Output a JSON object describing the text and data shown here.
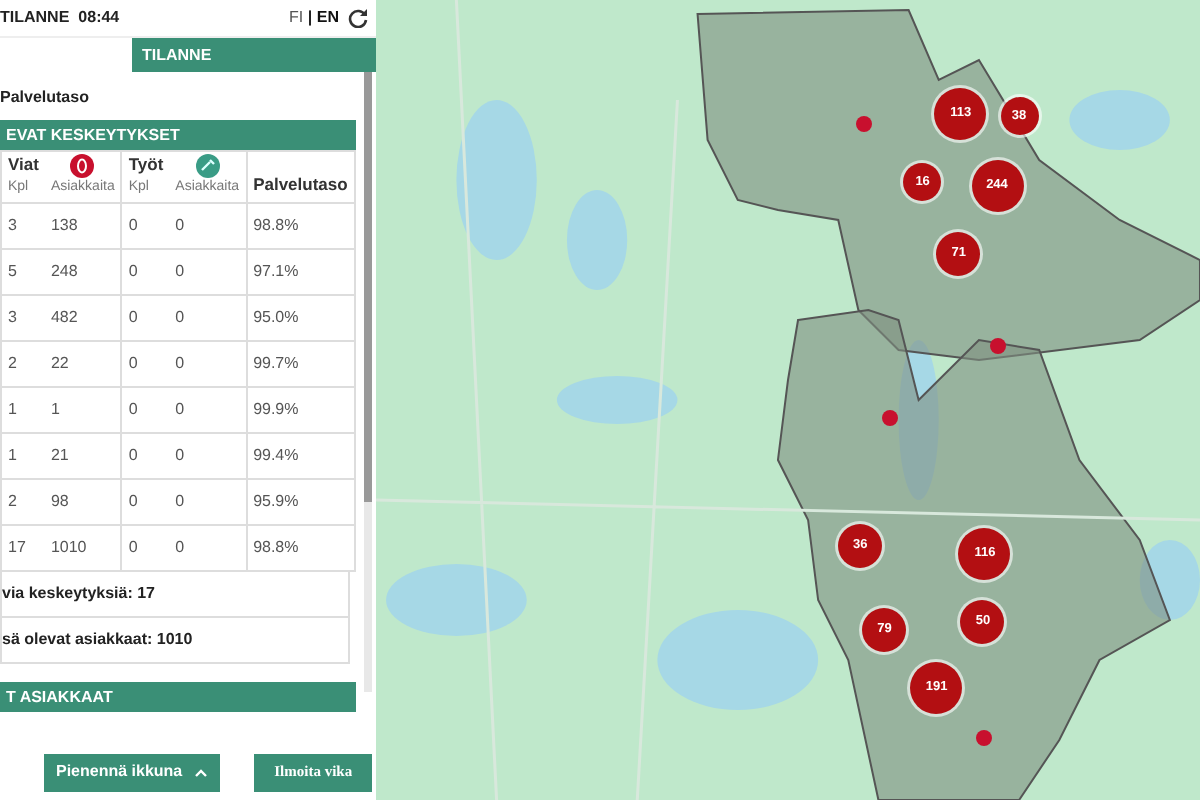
{
  "header": {
    "title": "TILANNE",
    "time": "08:44",
    "separator": "|",
    "languages": [
      {
        "label": "FI",
        "selected": false
      },
      {
        "label": "EN",
        "selected": true
      }
    ]
  },
  "tabs": [
    {
      "label": "TILANNE",
      "selected": true
    }
  ],
  "section_label": "Palvelutaso",
  "outages": {
    "title": "EVAT KESKEYTYKSET",
    "groups": [
      {
        "label": "Viat",
        "kind": "fault"
      },
      {
        "label": "Työt",
        "kind": "work"
      }
    ],
    "columns": [
      "Kpl",
      "Asiakkaita",
      "Kpl",
      "Asiakkaita",
      "Palvelutaso"
    ],
    "rows": [
      [
        "3",
        "138",
        "0",
        "0",
        "98.8%"
      ],
      [
        "5",
        "248",
        "0",
        "0",
        "97.1%"
      ],
      [
        "3",
        "482",
        "0",
        "0",
        "95.0%"
      ],
      [
        "2",
        "22",
        "0",
        "0",
        "99.7%"
      ],
      [
        "1",
        "1",
        "0",
        "0",
        "99.9%"
      ],
      [
        "1",
        "21",
        "0",
        "0",
        "99.4%"
      ],
      [
        "2",
        "98",
        "0",
        "0",
        "95.9%"
      ],
      [
        "17",
        "1010",
        "0",
        "0",
        "98.8%"
      ]
    ],
    "summary": [
      "via keskeytyksiä: 17",
      "sä olevat asiakkaat: 1010"
    ]
  },
  "customers": {
    "title": "T ASIAKKAAT"
  },
  "buttons": [
    {
      "label": "Pienennä ikkuna",
      "kind": "toggle"
    },
    {
      "label": "Ilmoita vika",
      "kind": "plain"
    }
  ],
  "map": {
    "clusters": [
      {
        "count": "113",
        "kind": "large"
      },
      {
        "count": "38",
        "kind": "small"
      },
      {
        "count": "16",
        "kind": "small"
      },
      {
        "count": "244",
        "kind": "large"
      },
      {
        "count": "71",
        "kind": "medium"
      },
      {
        "count": "36",
        "kind": "medium"
      },
      {
        "count": "116",
        "kind": "large"
      },
      {
        "count": "79",
        "kind": "medium"
      },
      {
        "count": "50",
        "kind": "medium"
      },
      {
        "count": "191",
        "kind": "large"
      }
    ]
  }
}
